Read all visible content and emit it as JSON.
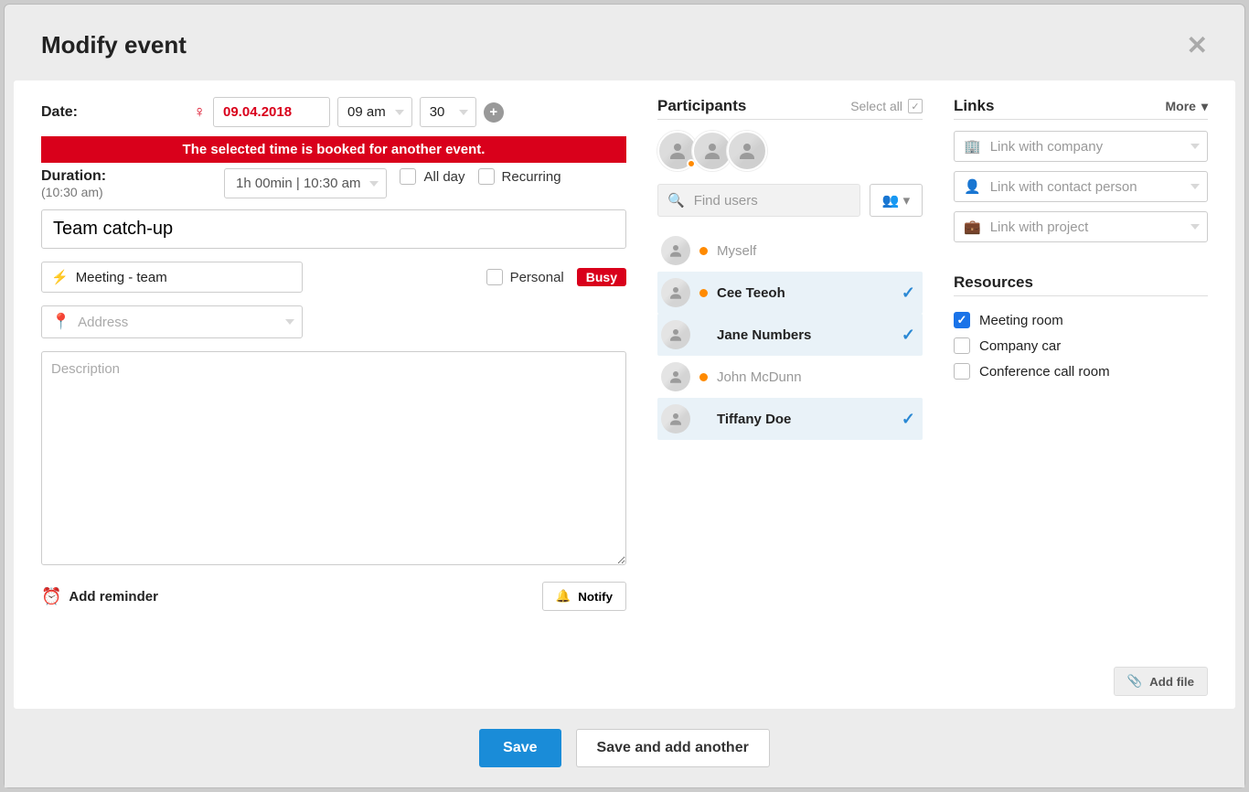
{
  "dialog": {
    "title": "Modify event",
    "date_label": "Date:",
    "date_value": "09.04.2018",
    "hour_value": "09 am",
    "minute_value": "30",
    "warning": "The selected time is booked for another event.",
    "duration_label": "Duration:",
    "duration_end_note": "(10:30 am)",
    "duration_value": "1h 00min  |  10:30 am",
    "all_day_label": "All day",
    "recurring_label": "Recurring",
    "event_title": "Team catch-up",
    "type_value": "Meeting - team",
    "personal_label": "Personal",
    "busy_badge": "Busy",
    "address_placeholder": "Address",
    "description_placeholder": "Description",
    "add_reminder": "Add reminder",
    "notify": "Notify"
  },
  "participants": {
    "heading": "Participants",
    "select_all": "Select all",
    "find_placeholder": "Find users",
    "avatars_shown": 3,
    "list": [
      {
        "name": "Myself",
        "selected": false,
        "busy": true,
        "bold": false
      },
      {
        "name": "Cee Teeoh",
        "selected": true,
        "busy": true,
        "bold": true
      },
      {
        "name": "Jane Numbers",
        "selected": true,
        "busy": false,
        "bold": true
      },
      {
        "name": "John McDunn",
        "selected": false,
        "busy": true,
        "bold": false
      },
      {
        "name": "Tiffany Doe",
        "selected": true,
        "busy": false,
        "bold": true
      }
    ]
  },
  "links": {
    "heading": "Links",
    "more": "More",
    "company_placeholder": "Link with company",
    "contact_placeholder": "Link with contact person",
    "project_placeholder": "Link with project"
  },
  "resources": {
    "heading": "Resources",
    "items": [
      {
        "label": "Meeting room",
        "checked": true
      },
      {
        "label": "Company car",
        "checked": false
      },
      {
        "label": "Conference call room",
        "checked": false
      }
    ]
  },
  "footer": {
    "add_file": "Add file",
    "save": "Save",
    "save_another": "Save and add another"
  }
}
